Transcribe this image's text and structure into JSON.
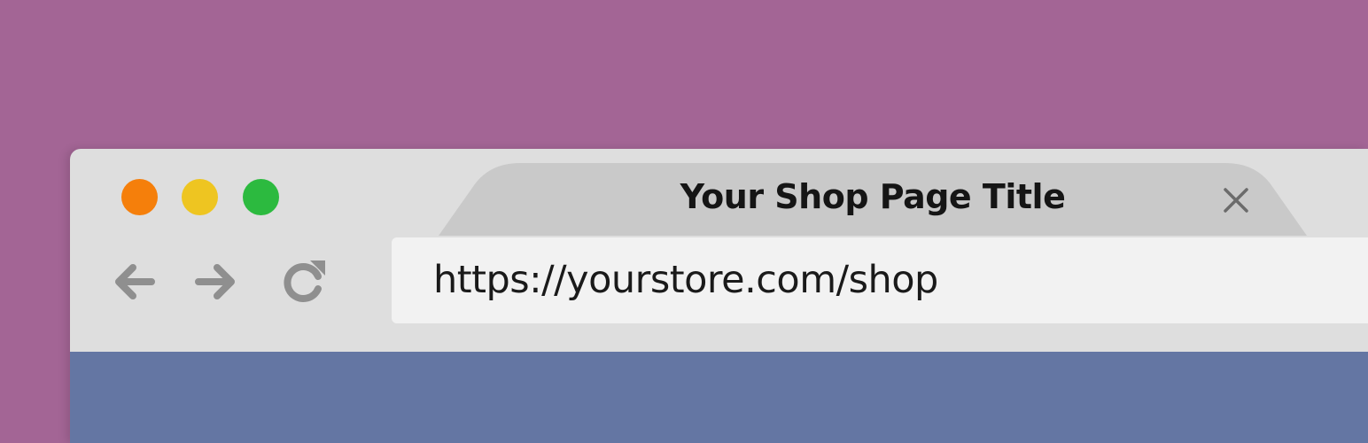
{
  "colors": {
    "background": "#a36595",
    "window_chrome": "#dedede",
    "tab": "#c9c9c9",
    "address_bar": "#f2f2f2",
    "page_content": "#6476a3",
    "traffic_close": "#f57f0b",
    "traffic_minimize": "#eec521",
    "traffic_maximize": "#2cba3f",
    "nav_icon": "#8f8f8f"
  },
  "icons": {
    "back": "arrow-left-icon",
    "forward": "arrow-right-icon",
    "reload": "reload-icon",
    "tab_close": "close-icon"
  },
  "tab": {
    "title": "Your Shop Page Title"
  },
  "address_bar": {
    "url": "https://yourstore.com/shop"
  }
}
